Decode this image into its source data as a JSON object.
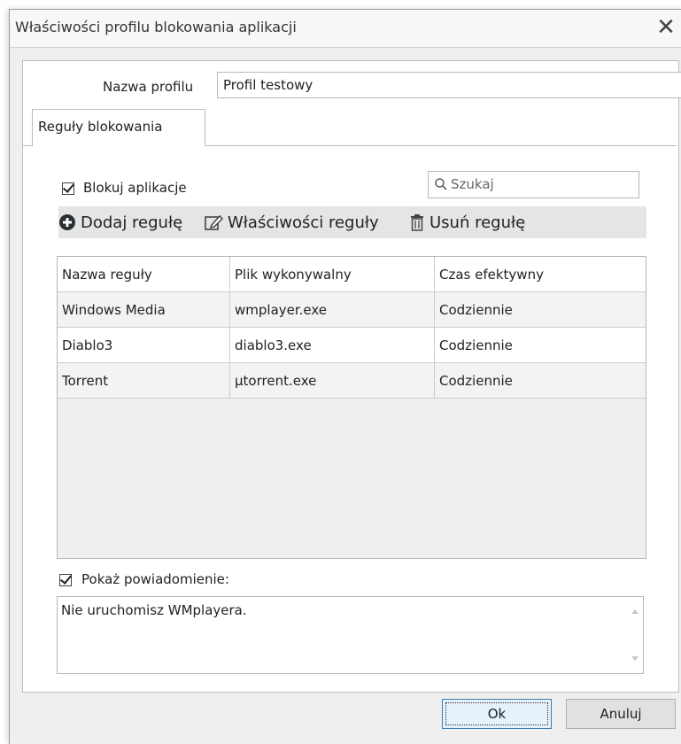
{
  "window": {
    "title": "Właściwości profilu blokowania aplikacji"
  },
  "profile": {
    "label": "Nazwa profilu",
    "value": "Profil testowy"
  },
  "tabs": [
    {
      "label": "Reguły blokowania",
      "active": true
    }
  ],
  "block_apps": {
    "label": "Blokuj aplikacje",
    "checked": true
  },
  "search": {
    "placeholder": "Szukaj",
    "icon": "search-icon"
  },
  "toolbar": {
    "add_label": "Dodaj regułę",
    "properties_label": "Właściwości reguły",
    "delete_label": "Usuń regułę"
  },
  "table": {
    "columns": [
      "Nazwa reguły",
      "Plik wykonywalny",
      "Czas efektywny"
    ],
    "rows": [
      [
        "Windows Media",
        "wmplayer.exe",
        "Codziennie"
      ],
      [
        "Diablo3",
        "diablo3.exe",
        "Codziennie"
      ],
      [
        "Torrent",
        "µtorrent.exe",
        "Codziennie"
      ]
    ]
  },
  "notification": {
    "label": "Pokaż powiadomienie:",
    "checked": true,
    "message": "Nie uruchomisz WMplayera."
  },
  "buttons": {
    "ok": "Ok",
    "cancel": "Anuluj"
  },
  "colors": {
    "accent": "#2a6fb0",
    "toolbar_bg": "#e5e5e5",
    "window_bg": "#efefef"
  }
}
